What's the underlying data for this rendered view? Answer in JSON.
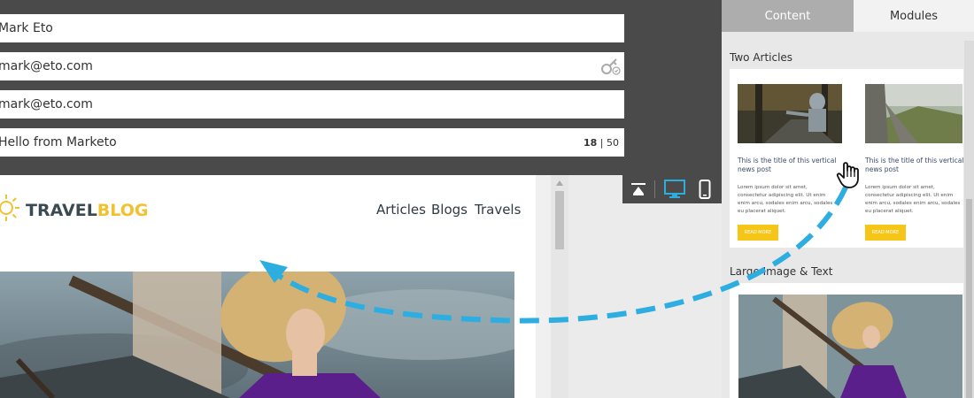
{
  "form": {
    "name_value": "Mark Eto",
    "email_value": "mark@eto.com",
    "reply_value": "mark@eto.com",
    "subject_value": "Hello from Marketo",
    "subject_count": "18",
    "subject_sep": " | ",
    "subject_max": "50"
  },
  "email_preview": {
    "logo_part1": "TRAVEL",
    "logo_part2": "BLOG",
    "nav": [
      "Articles",
      "Blogs",
      "Travels"
    ]
  },
  "sidebar": {
    "tabs": [
      "Content",
      "Modules"
    ],
    "active_tab": "Modules",
    "section1_label": "Two Articles",
    "section2_label": "Large Image & Text",
    "articles": [
      {
        "title": "This is the title of this vertical news post",
        "body": "Lorem ipsum dolor sit amet, consectetur adipiscing elit. Ut enim enim arcu, sodales enim arcu, sodales eu placerat aliquet.",
        "button": "READ MORE"
      },
      {
        "title": "This is the title of this vertical news post",
        "body": "Lorem ipsum dolor sit amet, consectetur adipiscing elit. Ut enim enim arcu, sodales enim arcu, sodales eu placerat aliquet.",
        "button": "READ MORE"
      }
    ]
  },
  "toolbar": {
    "icons": [
      "collapse-top-icon",
      "desktop-view-icon",
      "mobile-view-icon"
    ]
  },
  "colors": {
    "accent": "#2eaee0",
    "logo_dark": "#3a4a52",
    "logo_yellow": "#f2c12e",
    "button_yellow": "#f5c518",
    "dark_bar": "#4a4a4a"
  }
}
